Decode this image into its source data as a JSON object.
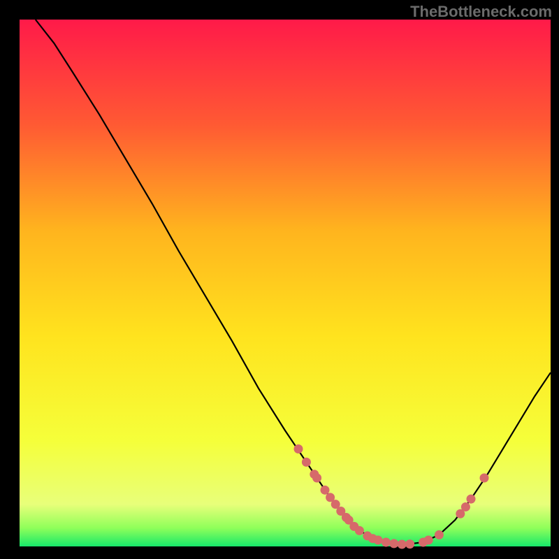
{
  "watermark": "TheBottleneck.com",
  "chart_data": {
    "type": "line",
    "title": "",
    "xlabel": "",
    "ylabel": "",
    "xlim": [
      0,
      100
    ],
    "ylim": [
      0,
      100
    ],
    "grid": false,
    "legend": false,
    "gradient_stops": [
      {
        "offset": 0.0,
        "color": "#ff1a49"
      },
      {
        "offset": 0.2,
        "color": "#ff5a33"
      },
      {
        "offset": 0.4,
        "color": "#ffb41e"
      },
      {
        "offset": 0.6,
        "color": "#ffe31e"
      },
      {
        "offset": 0.8,
        "color": "#f5ff3a"
      },
      {
        "offset": 0.92,
        "color": "#e8ff7a"
      },
      {
        "offset": 0.965,
        "color": "#8fff5a"
      },
      {
        "offset": 1.0,
        "color": "#17e86a"
      }
    ],
    "curve": [
      {
        "x": 3.0,
        "y": 100.0
      },
      {
        "x": 6.5,
        "y": 95.5
      },
      {
        "x": 10.0,
        "y": 90.0
      },
      {
        "x": 15.0,
        "y": 82.0
      },
      {
        "x": 20.0,
        "y": 73.5
      },
      {
        "x": 25.0,
        "y": 65.0
      },
      {
        "x": 30.0,
        "y": 56.0
      },
      {
        "x": 35.0,
        "y": 47.5
      },
      {
        "x": 40.0,
        "y": 39.0
      },
      {
        "x": 45.0,
        "y": 30.0
      },
      {
        "x": 50.0,
        "y": 22.0
      },
      {
        "x": 55.0,
        "y": 14.5
      },
      {
        "x": 58.0,
        "y": 10.0
      },
      {
        "x": 61.0,
        "y": 6.0
      },
      {
        "x": 64.0,
        "y": 3.0
      },
      {
        "x": 67.0,
        "y": 1.3
      },
      {
        "x": 70.0,
        "y": 0.6
      },
      {
        "x": 73.0,
        "y": 0.4
      },
      {
        "x": 76.0,
        "y": 0.8
      },
      {
        "x": 79.0,
        "y": 2.2
      },
      {
        "x": 82.0,
        "y": 5.0
      },
      {
        "x": 85.0,
        "y": 9.0
      },
      {
        "x": 88.0,
        "y": 13.5
      },
      {
        "x": 91.0,
        "y": 18.5
      },
      {
        "x": 94.0,
        "y": 23.5
      },
      {
        "x": 97.0,
        "y": 28.5
      },
      {
        "x": 100.0,
        "y": 33.0
      }
    ],
    "highlight_points": [
      {
        "x": 52.5,
        "y": 18.5
      },
      {
        "x": 54.0,
        "y": 16.0
      },
      {
        "x": 55.5,
        "y": 13.7
      },
      {
        "x": 56.0,
        "y": 13.0
      },
      {
        "x": 57.5,
        "y": 10.7
      },
      {
        "x": 58.5,
        "y": 9.3
      },
      {
        "x": 59.5,
        "y": 8.0
      },
      {
        "x": 60.5,
        "y": 6.7
      },
      {
        "x": 61.5,
        "y": 5.5
      },
      {
        "x": 62.0,
        "y": 5.0
      },
      {
        "x": 63.0,
        "y": 3.8
      },
      {
        "x": 64.0,
        "y": 3.0
      },
      {
        "x": 65.5,
        "y": 2.0
      },
      {
        "x": 66.5,
        "y": 1.5
      },
      {
        "x": 67.5,
        "y": 1.2
      },
      {
        "x": 69.0,
        "y": 0.8
      },
      {
        "x": 70.5,
        "y": 0.55
      },
      {
        "x": 72.0,
        "y": 0.4
      },
      {
        "x": 73.5,
        "y": 0.45
      },
      {
        "x": 76.0,
        "y": 0.8
      },
      {
        "x": 77.0,
        "y": 1.2
      },
      {
        "x": 79.0,
        "y": 2.2
      },
      {
        "x": 83.0,
        "y": 6.2
      },
      {
        "x": 84.0,
        "y": 7.5
      },
      {
        "x": 85.0,
        "y": 9.0
      },
      {
        "x": 87.5,
        "y": 13.0
      }
    ],
    "point_color": "#d66a6a",
    "curve_color": "#000000",
    "curve_width": 2.2,
    "point_radius": 6.5
  }
}
